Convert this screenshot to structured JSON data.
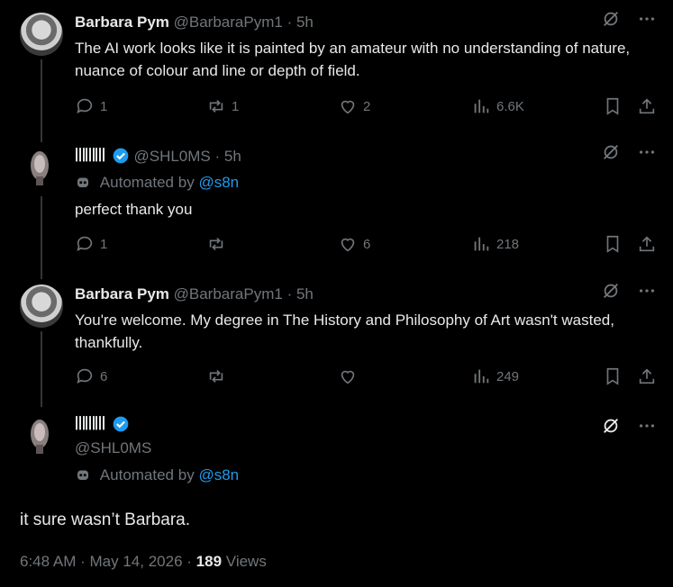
{
  "tweets": [
    {
      "name": "Barbara Pym",
      "handle": "@BarbaraPym1",
      "dot": "·",
      "time": "5h",
      "text": "The AI work looks like it is painted by an amateur with no understanding of nature, nuance of colour and line or depth of field.",
      "replies": "1",
      "reposts": "1",
      "likes": "2",
      "views": "6.6K"
    },
    {
      "name": "ꔖꔖꔖ",
      "handle": "@SHL0MS",
      "dot": "·",
      "time": "5h",
      "automated_prefix": "Automated by",
      "automated_link": "@s8n",
      "text": "perfect thank you",
      "replies": "1",
      "reposts": "",
      "likes": "6",
      "views": "218"
    },
    {
      "name": "Barbara Pym",
      "handle": "@BarbaraPym1",
      "dot": "·",
      "time": "5h",
      "text": "You're welcome. My degree in The History and Philosophy of Art wasn't wasted, thankfully.",
      "replies": "6",
      "reposts": "",
      "likes": "",
      "views": "249"
    }
  ],
  "main": {
    "name": "ꔖꔖꔖ",
    "handle": "@SHL0MS",
    "automated_prefix": "Automated by",
    "automated_link": "@s8n",
    "text": "it sure wasn’t Barbara.",
    "time": "6:48 AM",
    "date": "May 14, 2026",
    "sep": "·",
    "views_count": "189",
    "views_label": "Views"
  },
  "colors": {
    "accent": "#1d9bf0",
    "muted": "#71767b",
    "text": "#e7e9ea",
    "bg": "#000000"
  }
}
